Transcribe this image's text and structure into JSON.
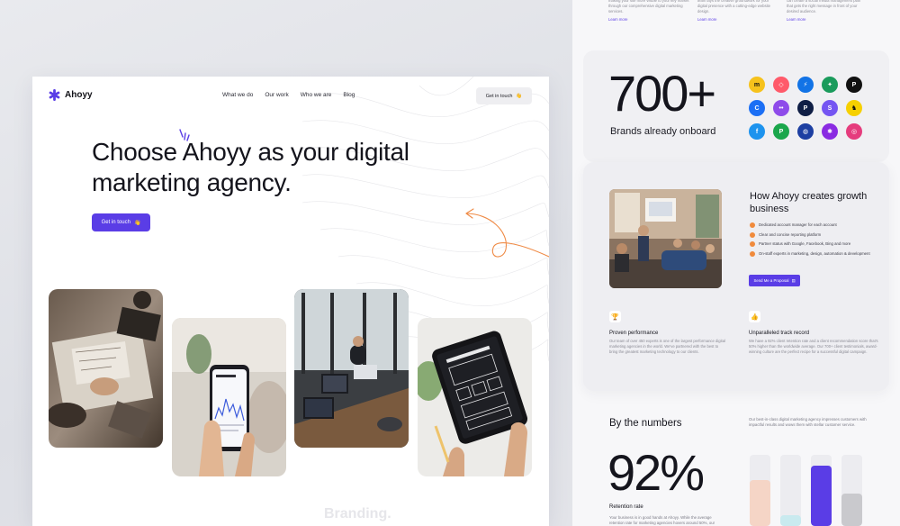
{
  "main": {
    "logo_text": "Ahoyy",
    "nav_links": [
      "What we do",
      "Our work",
      "Who we are",
      "Blog"
    ],
    "nav_cta": "Get in touch",
    "hero_title": "Choose Ahoyy as your digital marketing agency.",
    "hero_cta": "Get in touch",
    "wave_emoji": "👋",
    "branding_word": "Branding."
  },
  "top_strip": [
    {
      "text": "making your site more visible to your key market through our comprehensive digital marketing services.",
      "link": "Learn more"
    },
    {
      "text": "team lays the creative groundwork for your digital presence with a cutting-edge website design.",
      "link": "Learn more"
    },
    {
      "text": "can create a social media management plan that gets the right message in front of your desired audience.",
      "link": "Learn more"
    }
  ],
  "brands": {
    "count": "700+",
    "caption": "Brands already onboard",
    "logos": [
      {
        "name": "mailchimp-logo",
        "color": "#f6c21c",
        "glyph": "m",
        "fg": "#111"
      },
      {
        "name": "airbnb-logo",
        "color": "#ff5a6a",
        "glyph": "◇",
        "fg": "#fff"
      },
      {
        "name": "gitlab-logo",
        "color": "#1273e6",
        "glyph": "⚡",
        "fg": "#fff"
      },
      {
        "name": "leaf-logo",
        "color": "#1a9b5c",
        "glyph": "✦",
        "fg": "#fff"
      },
      {
        "name": "passport-logo",
        "color": "#111111",
        "glyph": "P",
        "fg": "#fff"
      },
      {
        "name": "c-logo",
        "color": "#1c6ff5",
        "glyph": "C",
        "fg": "#fff"
      },
      {
        "name": "flickr-logo",
        "color": "#8e4bea",
        "glyph": "••",
        "fg": "#fff"
      },
      {
        "name": "pandora-logo",
        "color": "#0f1e45",
        "glyph": "P",
        "fg": "#fff"
      },
      {
        "name": "s-logo",
        "color": "#7455f2",
        "glyph": "S",
        "fg": "#fff"
      },
      {
        "name": "bird-logo",
        "color": "#f6d000",
        "glyph": "♞",
        "fg": "#111"
      },
      {
        "name": "ebay-logo",
        "color": "#1d93ee",
        "glyph": "f",
        "fg": "#fff"
      },
      {
        "name": "p-green-logo",
        "color": "#1aa64b",
        "glyph": "P",
        "fg": "#fff"
      },
      {
        "name": "globe-logo",
        "color": "#1d3fa2",
        "glyph": "◍",
        "fg": "#fff"
      },
      {
        "name": "hub-logo",
        "color": "#8a2be2",
        "glyph": "✱",
        "fg": "#fff"
      },
      {
        "name": "dribbble-logo",
        "color": "#e53c7d",
        "glyph": "◎",
        "fg": "#fff"
      }
    ]
  },
  "growth": {
    "title": "How Ahoyy creates growth business",
    "items": [
      "Dedicated account manager for each account",
      "Clear and concise reporting platform",
      "Partner status with Google, Facebook, Bing and more",
      "On-staff experts in marketing, design, automation & development"
    ],
    "cta": "Send Me a Proposal"
  },
  "features": [
    {
      "icon": "🏆",
      "icon_name": "trophy-icon",
      "title": "Proven performance",
      "text": "Our team of over 450 experts is one of the largest performance digital marketing agencies in the world. We've partnered with the best to bring the greatest marketing technology to our clients."
    },
    {
      "icon": "👍",
      "icon_name": "thumbs-up-icon",
      "title": "Unparalleled track record",
      "text": "We have a 92% client retention rate and a client recommendation score that's 50% higher than the worldwide average. Our 700+ client testimonials, award-winning culture are the perfect recipe for a successful digital campaign."
    }
  ],
  "numbers": {
    "title": "By the numbers",
    "desc": "Our best-in-class digital marketing agency impresses customers with impactful results and wows them with stellar customer service.",
    "big": "92%",
    "label": "Retention rate",
    "text": "Your business is in good hands at Ahoyy. While the average retention rate for marketing agencies hovers around 50%, our",
    "bars": [
      {
        "fill": 0.65,
        "color": "#f5d5c6"
      },
      {
        "fill": 0.15,
        "color": "#c9eaef"
      },
      {
        "fill": 0.85,
        "color": "#5a3de6"
      },
      {
        "fill": 0.45,
        "color": "#c9c9cd"
      }
    ]
  }
}
